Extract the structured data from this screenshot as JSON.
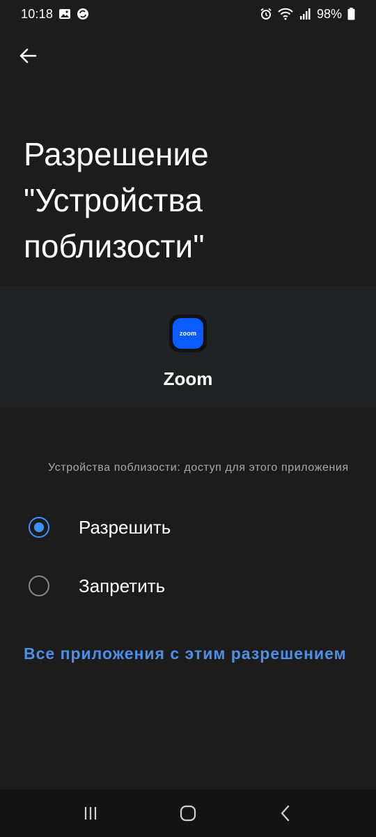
{
  "status_bar": {
    "time": "10:18",
    "battery": "98%",
    "icons_left": [
      "image-icon",
      "sync-icon"
    ],
    "icons_right": [
      "alarm-icon",
      "wifi-icon",
      "signal-icon",
      "battery-icon"
    ]
  },
  "header": {
    "title": "Разрешение \"Устройства поблизости\""
  },
  "app": {
    "name": "Zoom",
    "icon_text": "zoom",
    "icon_color": "#0b5cff"
  },
  "permission": {
    "section_label": "Устройства поблизости: доступ для этого приложения",
    "options": [
      {
        "label": "Разрешить",
        "selected": true
      },
      {
        "label": "Запретить",
        "selected": false
      }
    ]
  },
  "link": {
    "label": "Все приложения с этим разрешением"
  },
  "colors": {
    "background": "#1c1c1c",
    "accent": "#3e91ff",
    "link": "#4d8fe6"
  }
}
